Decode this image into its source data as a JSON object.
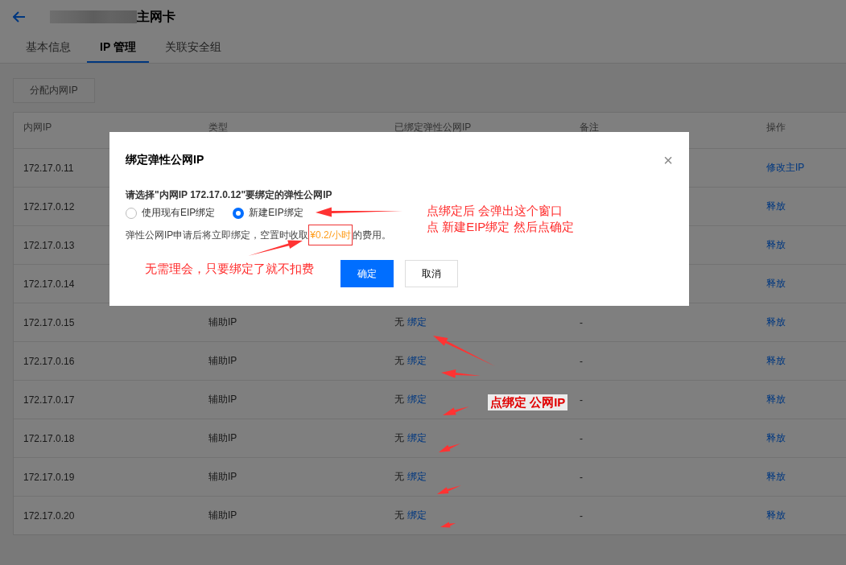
{
  "header": {
    "title": "主网卡"
  },
  "tabs": [
    {
      "label": "基本信息",
      "selected": false
    },
    {
      "label": "IP 管理",
      "selected": true
    },
    {
      "label": "关联安全组",
      "selected": false
    }
  ],
  "toolbar": {
    "allocate_button": {
      "label": "分配内网IP",
      "disabled": true
    }
  },
  "table": {
    "columns": [
      "内网IP",
      "类型",
      "已绑定弹性公网IP",
      "备注",
      "操作"
    ],
    "rows": [
      {
        "ip": "172.17.0.11",
        "action": "修改主IP"
      },
      {
        "ip": "172.17.0.12",
        "action": "释放"
      },
      {
        "ip": "172.17.0.13",
        "action": "释放"
      },
      {
        "ip": "172.17.0.14",
        "action": "释放"
      },
      {
        "ip": "172.17.0.15",
        "type": "辅助IP",
        "bound": "无",
        "bind_link": "绑定",
        "remark": "-",
        "action": "释放"
      },
      {
        "ip": "172.17.0.16",
        "type": "辅助IP",
        "bound": "无",
        "bind_link": "绑定",
        "remark": "-",
        "action": "释放"
      },
      {
        "ip": "172.17.0.17",
        "type": "辅助IP",
        "bound": "无",
        "bind_link": "绑定",
        "remark": "-",
        "action": "释放"
      },
      {
        "ip": "172.17.0.18",
        "type": "辅助IP",
        "bound": "无",
        "bind_link": "绑定",
        "remark": "-",
        "action": "释放"
      },
      {
        "ip": "172.17.0.19",
        "type": "辅助IP",
        "bound": "无",
        "bind_link": "绑定",
        "remark": "-",
        "action": "释放"
      },
      {
        "ip": "172.17.0.20",
        "type": "辅助IP",
        "bound": "无",
        "bind_link": "绑定",
        "remark": "-",
        "action": "释放"
      }
    ]
  },
  "dialog": {
    "title": "绑定弹性公网IP",
    "close": "×",
    "question": "请选择\"内网IP 172.17.0.12\"要绑定的弹性公网IP",
    "options": [
      {
        "label": "使用现有EIP绑定",
        "selected": false
      },
      {
        "label": "新建EIP绑定",
        "selected": true
      }
    ],
    "note_before": "弹性公网IP申请后将立即绑定，空置时收取",
    "price": "¥0.2/小时",
    "note_after": "的费用。",
    "confirm": "确定",
    "cancel": "取消"
  },
  "annotations": [
    {
      "lines": [
        "点绑定后  会弹出这个窗口",
        "点  新建EIP绑定  然后点确定"
      ]
    },
    {
      "lines": [
        "无需理会，只要绑定了就不扣费"
      ]
    },
    {
      "lines": [
        "点绑定  公网IP"
      ]
    }
  ]
}
